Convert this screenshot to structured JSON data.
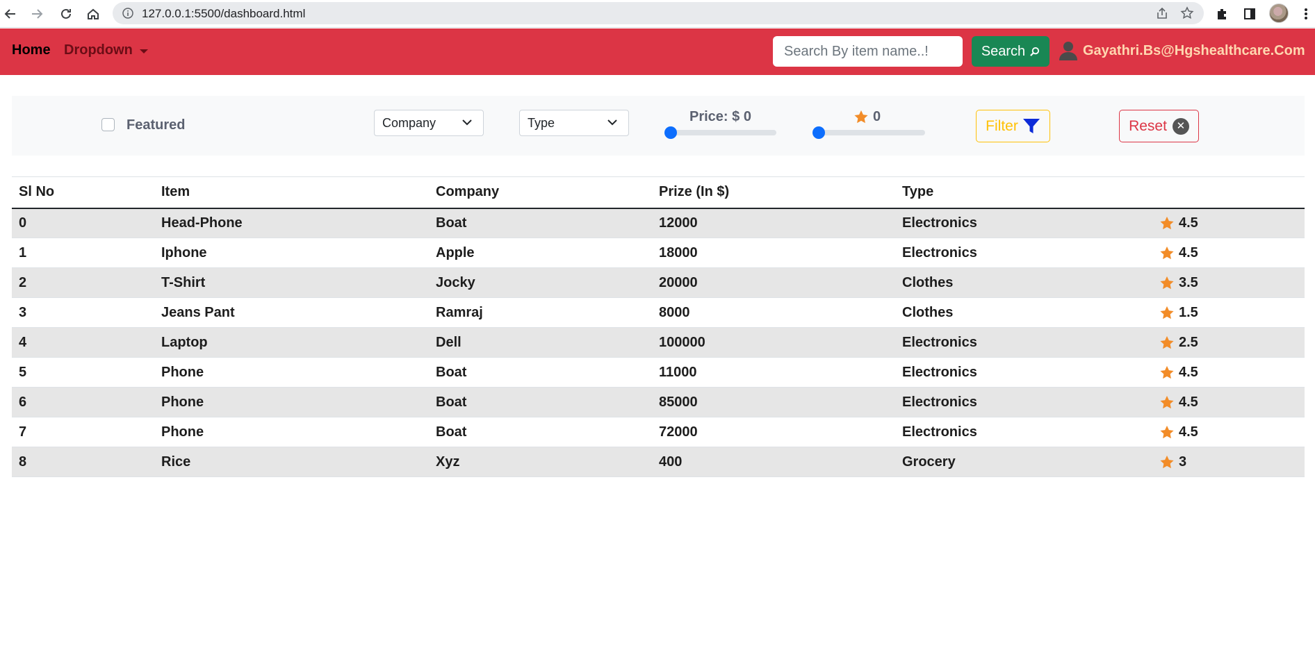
{
  "browser": {
    "url": "127.0.0.1:5500/dashboard.html"
  },
  "navbar": {
    "home_label": "Home",
    "dropdown_label": "Dropdown",
    "search_placeholder": "Search By item name..!",
    "search_button_label": "Search",
    "user_email": "Gayathri.Bs@Hgshealthcare.Com",
    "brand_color": "#dc3545"
  },
  "filters": {
    "featured_label": "Featured",
    "featured_checked": false,
    "company_select": "Company",
    "type_select": "Type",
    "price_label": "Price: $ 0",
    "price_value": 0,
    "rating_value": "0",
    "filter_button_label": "Filter",
    "reset_button_label": "Reset"
  },
  "table": {
    "headers": [
      "Sl No",
      "Item",
      "Company",
      "Prize (In $)",
      "Type",
      ""
    ],
    "rows": [
      {
        "sl": "0",
        "item": "Head-Phone",
        "company": "Boat",
        "price": "12000",
        "type": "Electronics",
        "rating": "4.5"
      },
      {
        "sl": "1",
        "item": "Iphone",
        "company": "Apple",
        "price": "18000",
        "type": "Electronics",
        "rating": "4.5"
      },
      {
        "sl": "2",
        "item": "T-Shirt",
        "company": "Jocky",
        "price": "20000",
        "type": "Clothes",
        "rating": "3.5"
      },
      {
        "sl": "3",
        "item": "Jeans Pant",
        "company": "Ramraj",
        "price": "8000",
        "type": "Clothes",
        "rating": "1.5"
      },
      {
        "sl": "4",
        "item": "Laptop",
        "company": "Dell",
        "price": "100000",
        "type": "Electronics",
        "rating": "2.5"
      },
      {
        "sl": "5",
        "item": "Phone",
        "company": "Boat",
        "price": "11000",
        "type": "Electronics",
        "rating": "4.5"
      },
      {
        "sl": "6",
        "item": "Phone",
        "company": "Boat",
        "price": "85000",
        "type": "Electronics",
        "rating": "4.5"
      },
      {
        "sl": "7",
        "item": "Phone",
        "company": "Boat",
        "price": "72000",
        "type": "Electronics",
        "rating": "4.5"
      },
      {
        "sl": "8",
        "item": "Rice",
        "company": "Xyz",
        "price": "400",
        "type": "Grocery",
        "rating": "3"
      }
    ]
  }
}
